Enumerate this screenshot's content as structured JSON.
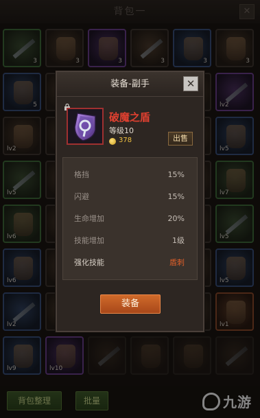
{
  "background": {
    "title": "背包一",
    "close_symbol": "✕",
    "slots": [
      {
        "label": "",
        "num": "3",
        "tone": "green"
      },
      {
        "label": "",
        "num": "3",
        "tone": ""
      },
      {
        "label": "",
        "num": "3",
        "tone": "purple"
      },
      {
        "label": "",
        "num": "3",
        "tone": ""
      },
      {
        "label": "",
        "num": "3",
        "tone": "blue"
      },
      {
        "label": "",
        "num": "3",
        "tone": ""
      },
      {
        "label": "",
        "num": "5",
        "tone": "blue"
      },
      {
        "label": "",
        "num": "",
        "tone": ""
      },
      {
        "label": "",
        "num": "",
        "tone": ""
      },
      {
        "label": "",
        "num": "",
        "tone": ""
      },
      {
        "label": "",
        "num": "",
        "tone": ""
      },
      {
        "label": "lv2",
        "num": "",
        "tone": "purple"
      },
      {
        "label": "lv2",
        "num": "",
        "tone": ""
      },
      {
        "label": "",
        "num": "",
        "tone": ""
      },
      {
        "label": "",
        "num": "",
        "tone": ""
      },
      {
        "label": "",
        "num": "",
        "tone": ""
      },
      {
        "label": "",
        "num": "",
        "tone": ""
      },
      {
        "label": "lv5",
        "num": "",
        "tone": "blue"
      },
      {
        "label": "lv5",
        "num": "",
        "tone": "green"
      },
      {
        "label": "",
        "num": "",
        "tone": ""
      },
      {
        "label": "",
        "num": "",
        "tone": ""
      },
      {
        "label": "",
        "num": "",
        "tone": ""
      },
      {
        "label": "",
        "num": "",
        "tone": ""
      },
      {
        "label": "lv7",
        "num": "",
        "tone": "green"
      },
      {
        "label": "lv6",
        "num": "",
        "tone": "green"
      },
      {
        "label": "",
        "num": "",
        "tone": ""
      },
      {
        "label": "",
        "num": "",
        "tone": ""
      },
      {
        "label": "",
        "num": "",
        "tone": ""
      },
      {
        "label": "",
        "num": "",
        "tone": ""
      },
      {
        "label": "lv5",
        "num": "",
        "tone": "green"
      },
      {
        "label": "lv6",
        "num": "",
        "tone": "blue"
      },
      {
        "label": "",
        "num": "",
        "tone": ""
      },
      {
        "label": "",
        "num": "",
        "tone": ""
      },
      {
        "label": "",
        "num": "",
        "tone": ""
      },
      {
        "label": "",
        "num": "",
        "tone": ""
      },
      {
        "label": "lv5",
        "num": "",
        "tone": "blue"
      },
      {
        "label": "lv2",
        "num": "",
        "tone": "blue"
      },
      {
        "label": "",
        "num": "",
        "tone": ""
      },
      {
        "label": "",
        "num": "",
        "tone": ""
      },
      {
        "label": "",
        "num": "",
        "tone": ""
      },
      {
        "label": "",
        "num": "",
        "tone": ""
      },
      {
        "label": "lv1",
        "num": "",
        "tone": "orange"
      },
      {
        "label": "lv9",
        "num": "",
        "tone": "blue"
      },
      {
        "label": "lv10",
        "num": "",
        "tone": "purple"
      },
      {
        "label": "",
        "num": "",
        "tone": "dim"
      },
      {
        "label": "",
        "num": "",
        "tone": "dim"
      },
      {
        "label": "",
        "num": "",
        "tone": "dim"
      },
      {
        "label": "",
        "num": "",
        "tone": "dim"
      }
    ],
    "sort_button": "背包整理",
    "batch_button": "批量",
    "watermark": "九游"
  },
  "modal": {
    "title": "装备-副手",
    "close_symbol": "✕",
    "item": {
      "name": "破魔之盾",
      "level": "等级10",
      "price": "378",
      "name_color": "#e04030"
    },
    "sell_label": "出售",
    "stats": [
      {
        "key": "格挡",
        "value": "15%"
      },
      {
        "key": "闪避",
        "value": "15%"
      },
      {
        "key": "生命增加",
        "value": "20%"
      },
      {
        "key": "技能增加",
        "value": "1级"
      },
      {
        "key": "强化技能",
        "value": "盾刺"
      }
    ],
    "equip_label": "装备"
  }
}
